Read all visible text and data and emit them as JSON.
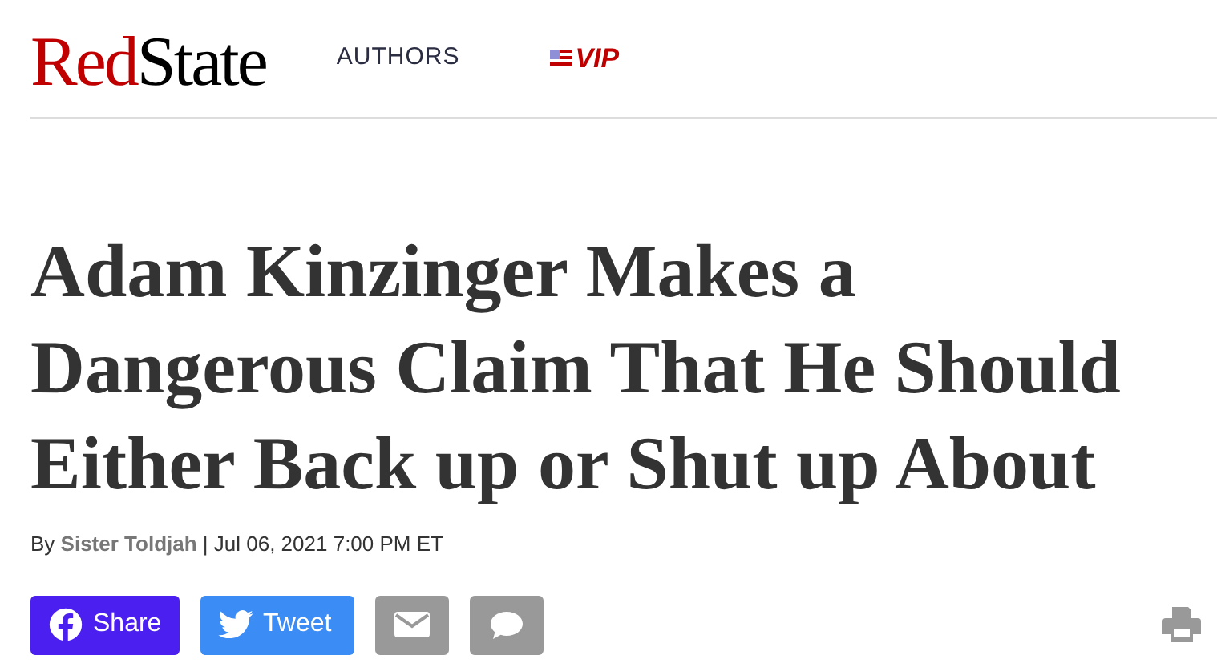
{
  "logo": {
    "part_1": "Red",
    "part_2": "State"
  },
  "nav": [
    {
      "kind": "link",
      "label": "AUTHORS"
    },
    {
      "kind": "vip",
      "label": "VIP"
    }
  ],
  "headline": "Adam Kinzinger Makes a Dangerous Claim That He Should Either Back up or Shut up About",
  "byline": {
    "prefix": "By",
    "author": "Sister Toldjah",
    "date": "| Jul 06, 2021 7:00 PM ET"
  },
  "share_buttons": [
    {
      "kind": "facebook",
      "label": "Share"
    },
    {
      "kind": "twitter",
      "label": "Tweet"
    },
    {
      "kind": "email"
    },
    {
      "kind": "comment"
    }
  ]
}
